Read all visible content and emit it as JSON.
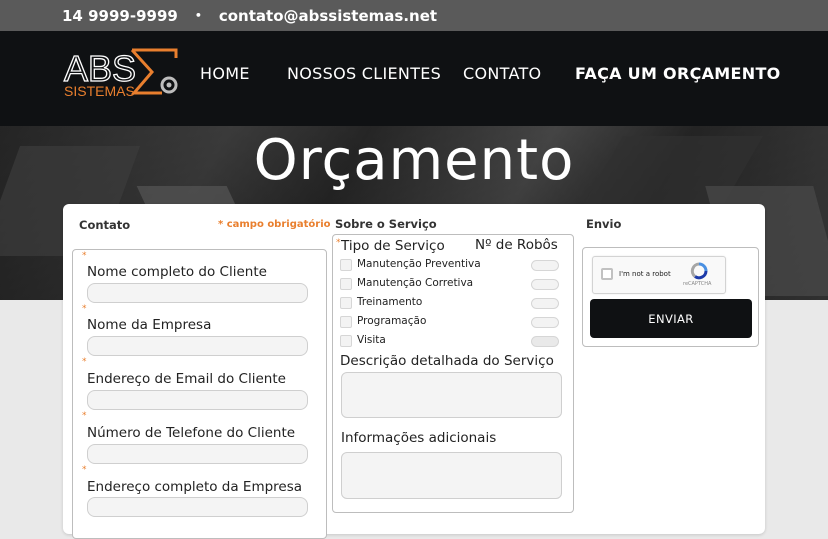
{
  "topbar": {
    "phone": "14 9999-9999",
    "separator": "•",
    "email": "contato@abssistemas.net"
  },
  "logo": {
    "word1": "ABS",
    "word2": "SISTEMAS"
  },
  "nav": {
    "items": [
      "HOME",
      "NOSSOS CLIENTES",
      "CONTATO",
      "FAÇA UM ORÇAMENTO"
    ]
  },
  "hero": {
    "title": "Orçamento"
  },
  "contato": {
    "title": "Contato",
    "required_note": "* campo obrigatório",
    "fields": [
      "Nome completo do Cliente",
      "Nome da Empresa",
      "Endereço de Email do Cliente",
      "Número de Telefone do Cliente",
      "Endereço completo da Empresa"
    ]
  },
  "servico": {
    "title": "Sobre o Serviço",
    "tipo_label": "Tipo de Serviço",
    "robos_label": "Nº de Robôs",
    "options": [
      "Manutenção Preventiva",
      "Manutenção Corretiva",
      "Treinamento",
      "Programação",
      "Visita"
    ],
    "descricao_label": "Descrição detalhada do Serviço",
    "info_label": "Informações adicionais"
  },
  "envio": {
    "title": "Envio",
    "captcha_text": "I'm not a robot",
    "captcha_brand": "reCAPTCHA",
    "send_label": "ENVIAR"
  },
  "colors": {
    "accent": "#e97f2e",
    "dark": "#0f1113",
    "topbar": "#5a5a5a"
  }
}
